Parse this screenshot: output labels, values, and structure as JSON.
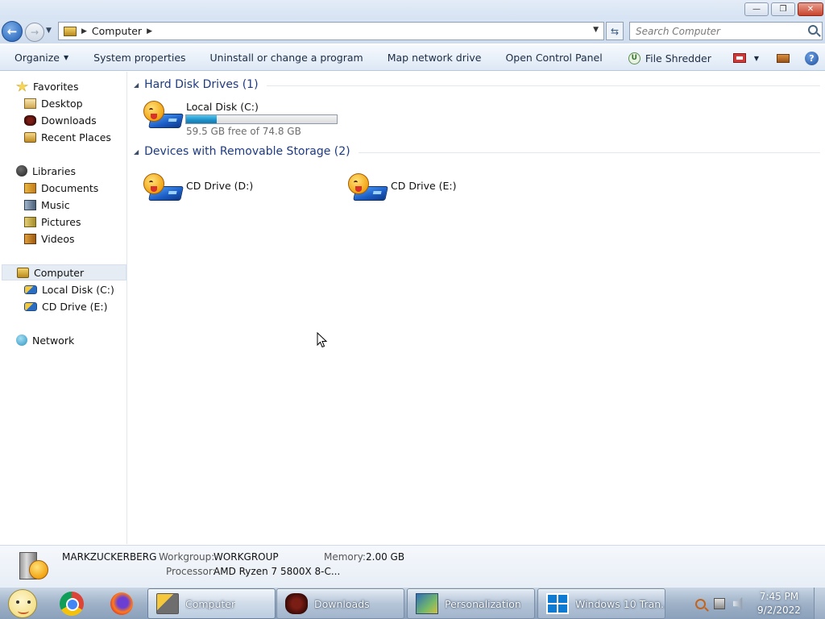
{
  "window": {
    "minimize_glyph": "—",
    "restore_glyph": "❐",
    "close_glyph": "✕"
  },
  "address": {
    "back_glyph": "←",
    "forward_glyph": "→",
    "dropdown_glyph": "▼",
    "separator": "▶",
    "location": "Computer",
    "refresh_glyph": "⇆"
  },
  "search": {
    "placeholder": "Search Computer"
  },
  "toolbar": {
    "organize": "Organize",
    "caret": "▼",
    "system_properties": "System properties",
    "uninstall": "Uninstall or change a program",
    "map_network": "Map network drive",
    "control_panel": "Open Control Panel",
    "file_shredder": "File Shredder",
    "shredder_glyph": "U",
    "help_glyph": "?"
  },
  "nav": {
    "favorites": "Favorites",
    "desktop": "Desktop",
    "downloads": "Downloads",
    "recent_places": "Recent Places",
    "libraries": "Libraries",
    "documents": "Documents",
    "music": "Music",
    "pictures": "Pictures",
    "videos": "Videos",
    "computer": "Computer",
    "local_disk": "Local Disk (C:)",
    "cd_drive": "CD Drive (E:)",
    "network": "Network"
  },
  "content": {
    "group_arrow": "◢",
    "hard_disk_header": "Hard Disk Drives (1)",
    "removable_header": "Devices with Removable Storage (2)",
    "local_disk_name": "Local Disk (C:)",
    "local_disk_free": "59.5 GB free of 74.8 GB",
    "local_disk_used_fraction": 0.205,
    "cd_drive_d": "CD Drive (D:)",
    "cd_drive_e": "CD Drive (E:)"
  },
  "details": {
    "computer_name": "MARKZUCKERBERG",
    "workgroup_label": "Workgroup:",
    "workgroup_value": "WORKGROUP",
    "memory_label": "Memory:",
    "memory_value": "2.00 GB",
    "processor_label": "Processor:",
    "processor_value": "AMD Ryzen 7 5800X 8-C..."
  },
  "taskbar": {
    "computer": "Computer",
    "downloads": "Downloads",
    "personalization": "Personalization",
    "windows10": "Windows 10 Tran...",
    "time": "7:45 PM",
    "date": "9/2/2022"
  },
  "colors": {
    "accent_header": "#1e3a80",
    "drive_bar_fill": "#1e90c8",
    "taskbar": "#9fb2c8"
  }
}
